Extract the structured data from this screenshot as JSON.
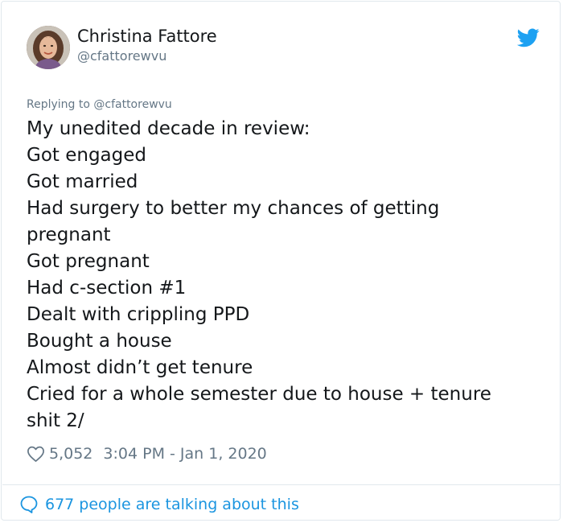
{
  "author": {
    "display_name": "Christina Fattore",
    "handle": "@cfattorewvu"
  },
  "icons": {
    "brand": "twitter-bird-icon",
    "like": "heart-outline-icon",
    "conversation": "speech-bubble-icon"
  },
  "colors": {
    "brand_blue": "#1da1f2",
    "link_blue": "#1b95e0",
    "muted_gray": "#657786",
    "text_dark": "#14171a"
  },
  "tweet": {
    "replying_to": "Replying to @cfattorewvu",
    "lines": [
      "My unedited decade in review:",
      "Got engaged",
      "Got married",
      "Had surgery to better my chances of getting",
      "pregnant",
      "Got pregnant",
      "Had c-section #1",
      "Dealt with crippling PPD",
      "Bought a house",
      "Almost didn’t get tenure",
      "Cried for a whole semester due to house + tenure",
      "shit 2/"
    ],
    "likes": "5,052",
    "timestamp": "3:04 PM - Jan 1, 2020"
  },
  "footer": {
    "conversation_text": "677 people are talking about this"
  }
}
